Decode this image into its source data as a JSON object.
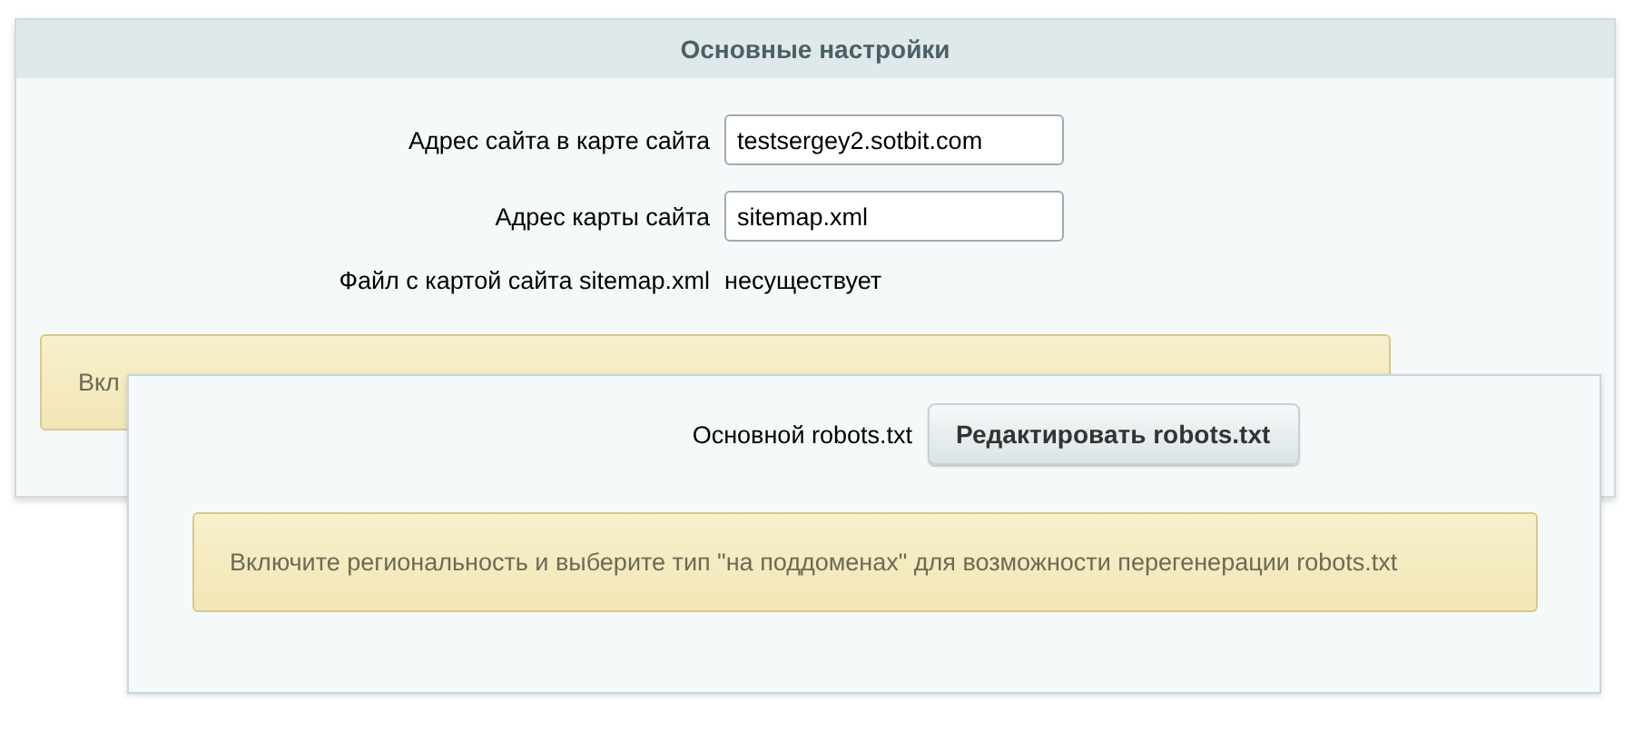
{
  "main_panel": {
    "title": "Основные настройки",
    "fields": [
      {
        "label": "Адрес сайта в карте сайта",
        "value": "testsergey2.sotbit.com"
      },
      {
        "label": "Адрес карты сайта",
        "value": "sitemap.xml"
      }
    ],
    "file_status": {
      "label": "Файл с картой сайта sitemap.xml",
      "value": "несуществует"
    },
    "notice": "Вкл"
  },
  "robots_panel": {
    "label": "Основной robots.txt",
    "button": "Редактировать robots.txt",
    "notice": "Включите региональность и выберите тип \"на поддоменах\" для возможности перегенерации robots.txt"
  }
}
